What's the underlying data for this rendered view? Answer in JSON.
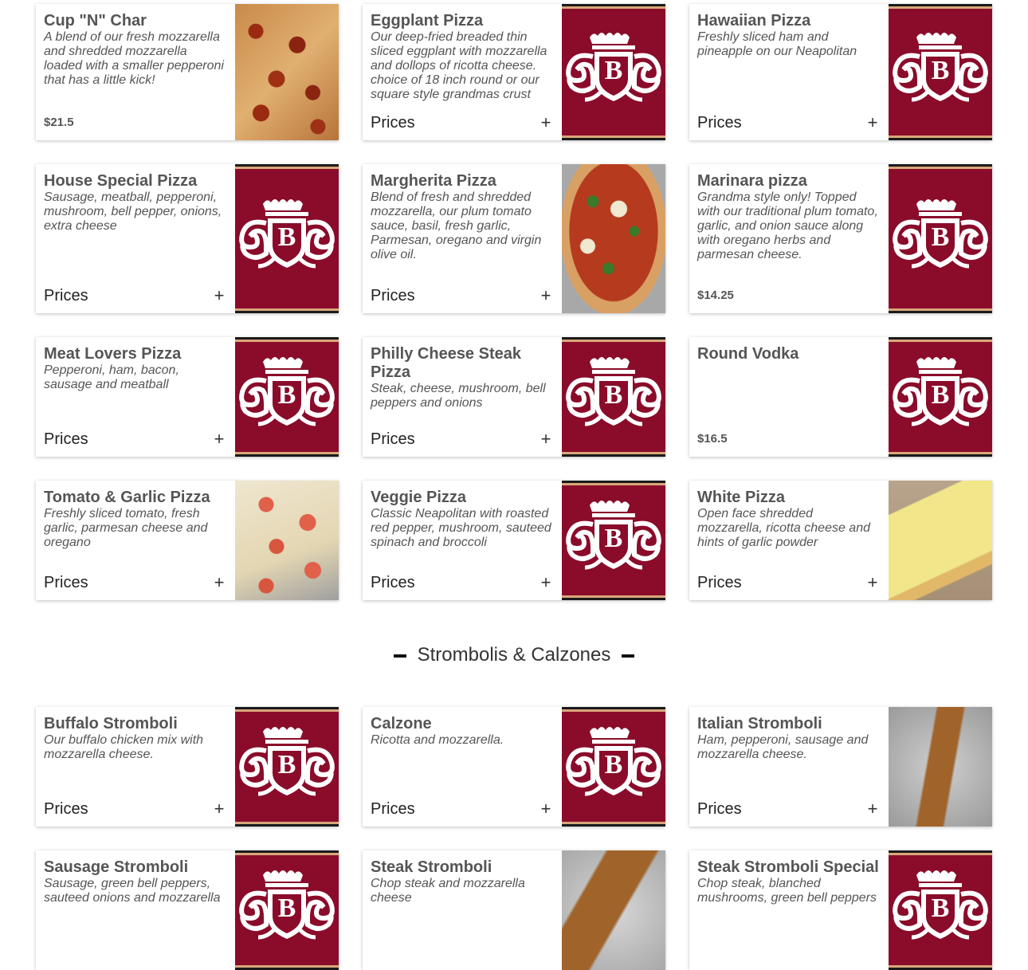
{
  "section": {
    "title": "Strombolis & Calzones"
  },
  "cards": [
    {
      "title": "Cup \"N\" Char",
      "desc": "A blend of our fresh mozzarella and shredded mozzarella loaded with a smaller pepperoni that has a little kick!",
      "price": "$21.5",
      "image": "pepperoni-photo"
    },
    {
      "title": "Eggplant Pizza",
      "desc": "Our deep-fried breaded thin sliced eggplant with mozzarella and dollops of ricotta cheese. choice of 18 inch round or our square style grandmas crust",
      "prices_label": "Prices",
      "image": "logo"
    },
    {
      "title": "Hawaiian Pizza",
      "desc": "Freshly sliced ham and pineapple on our Neapolitan",
      "prices_label": "Prices",
      "image": "logo"
    },
    {
      "title": "House Special Pizza",
      "desc": "Sausage, meatball, pepperoni, mushroom, bell pepper, onions, extra cheese",
      "prices_label": "Prices",
      "image": "logo"
    },
    {
      "title": "Margherita Pizza",
      "desc": "Blend of fresh and shredded mozzarella, our plum tomato sauce, basil, fresh garlic, Parmesan, oregano and virgin olive oil.",
      "prices_label": "Prices",
      "image": "margherita-photo"
    },
    {
      "title": "Marinara pizza",
      "desc": "Grandma style only! Topped with our traditional plum tomato, garlic, and onion sauce along with oregano herbs and parmesan cheese.",
      "price": "$14.25",
      "image": "logo"
    },
    {
      "title": "Meat Lovers Pizza",
      "desc": "Pepperoni, ham, bacon, sausage and meatball",
      "prices_label": "Prices",
      "image": "logo"
    },
    {
      "title": "Philly Cheese Steak Pizza",
      "desc": "Steak, cheese, mushroom, bell peppers and onions",
      "prices_label": "Prices",
      "image": "logo"
    },
    {
      "title": "Round Vodka",
      "desc": "",
      "price": "$16.5",
      "image": "logo"
    },
    {
      "title": "Tomato & Garlic Pizza",
      "desc": "Freshly sliced tomato, fresh garlic, parmesan cheese and oregano",
      "prices_label": "Prices",
      "image": "tomato-photo"
    },
    {
      "title": "Veggie Pizza",
      "desc": "Classic Neapolitan with roasted red pepper, mushroom, sauteed spinach and broccoli",
      "prices_label": "Prices",
      "image": "logo"
    },
    {
      "title": "White Pizza",
      "desc": "Open face shredded mozzarella, ricotta cheese and hints of garlic powder",
      "prices_label": "Prices",
      "image": "white-photo"
    },
    {
      "title": "Buffalo Stromboli",
      "desc": "Our buffalo chicken mix with mozzarella cheese.",
      "prices_label": "Prices",
      "image": "logo"
    },
    {
      "title": "Calzone",
      "desc": "Ricotta and mozzarella.",
      "prices_label": "Prices",
      "image": "logo"
    },
    {
      "title": "Italian Stromboli",
      "desc": "Ham, pepperoni, sausage and mozzarella cheese.",
      "prices_label": "Prices",
      "image": "stromboli-photo"
    },
    {
      "title": "Sausage Stromboli",
      "desc": "Sausage, green bell peppers, sauteed onions and mozzarella",
      "image": "logo"
    },
    {
      "title": "Steak Stromboli",
      "desc": "Chop steak and mozzarella cheese",
      "image": "stromboli-photo"
    },
    {
      "title": "Steak Stromboli Special",
      "desc": "Chop steak, blanched mushrooms, green bell peppers",
      "image": "logo"
    }
  ],
  "colors": {
    "brand": "#8a0c2a",
    "trim": "#d9a77a"
  }
}
